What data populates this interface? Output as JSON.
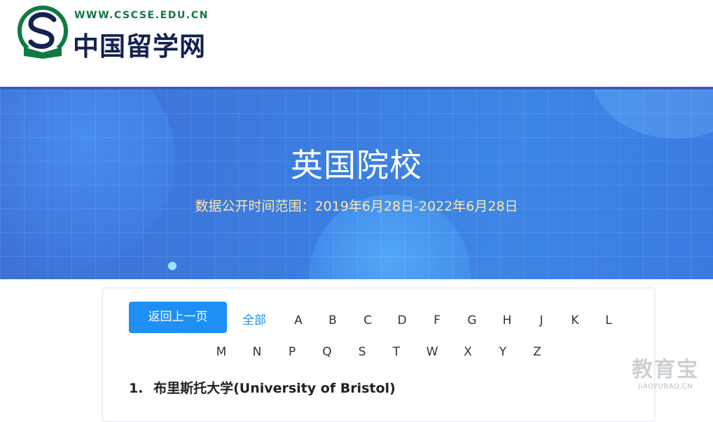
{
  "header": {
    "logo_url_text": "WWW.CSCSE.EDU.CN",
    "logo_cn_text": "中国留学网"
  },
  "banner": {
    "title": "英国院校",
    "subtitle": "数据公开时间范围：2019年6月28日-2022年6月28日"
  },
  "filter": {
    "back_label": "返回上一页",
    "all_label": "全部",
    "letters": [
      "A",
      "B",
      "C",
      "D",
      "F",
      "G",
      "H",
      "J",
      "K",
      "L",
      "M",
      "N",
      "P",
      "Q",
      "S",
      "T",
      "W",
      "X",
      "Y",
      "Z"
    ]
  },
  "schools": [
    {
      "index": "1.",
      "name": "布里斯托大学(University of Bristol)"
    }
  ],
  "watermark": {
    "cn": "教育宝",
    "en": "JIAOYUBAO.CN"
  },
  "colors": {
    "accent": "#1e90f5",
    "banner": "#3b7de0",
    "subtitle": "#ffe7a8",
    "logo_green": "#0f7a43"
  }
}
